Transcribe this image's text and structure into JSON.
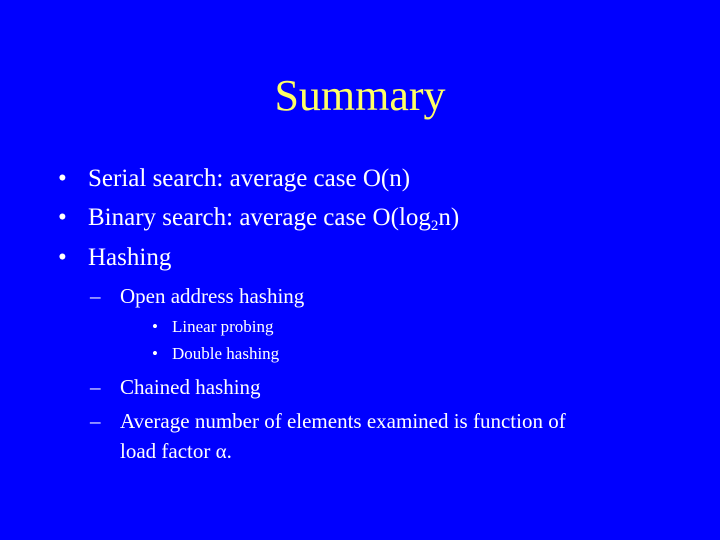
{
  "slide": {
    "title": "Summary",
    "colors": {
      "background": "#0000FF",
      "title": "#FFFF66",
      "text": "#FFFFFF"
    },
    "bullets": [
      {
        "text": "Serial search: average case O(n)"
      },
      {
        "text_before_sub": "Binary search: average case O(log",
        "sub": "2",
        "text_after_sub": "n)"
      },
      {
        "text": "Hashing"
      }
    ],
    "hashing_subitems": [
      {
        "text": "Open address hashing"
      },
      {
        "text": "Chained hashing"
      },
      {
        "text": "Average number of elements examined is function of",
        "continuation": "load factor α."
      }
    ],
    "open_address_methods": [
      {
        "text": "Linear probing"
      },
      {
        "text": "Double hashing"
      }
    ],
    "bullet_glyph": "•",
    "dash_glyph": "–"
  }
}
